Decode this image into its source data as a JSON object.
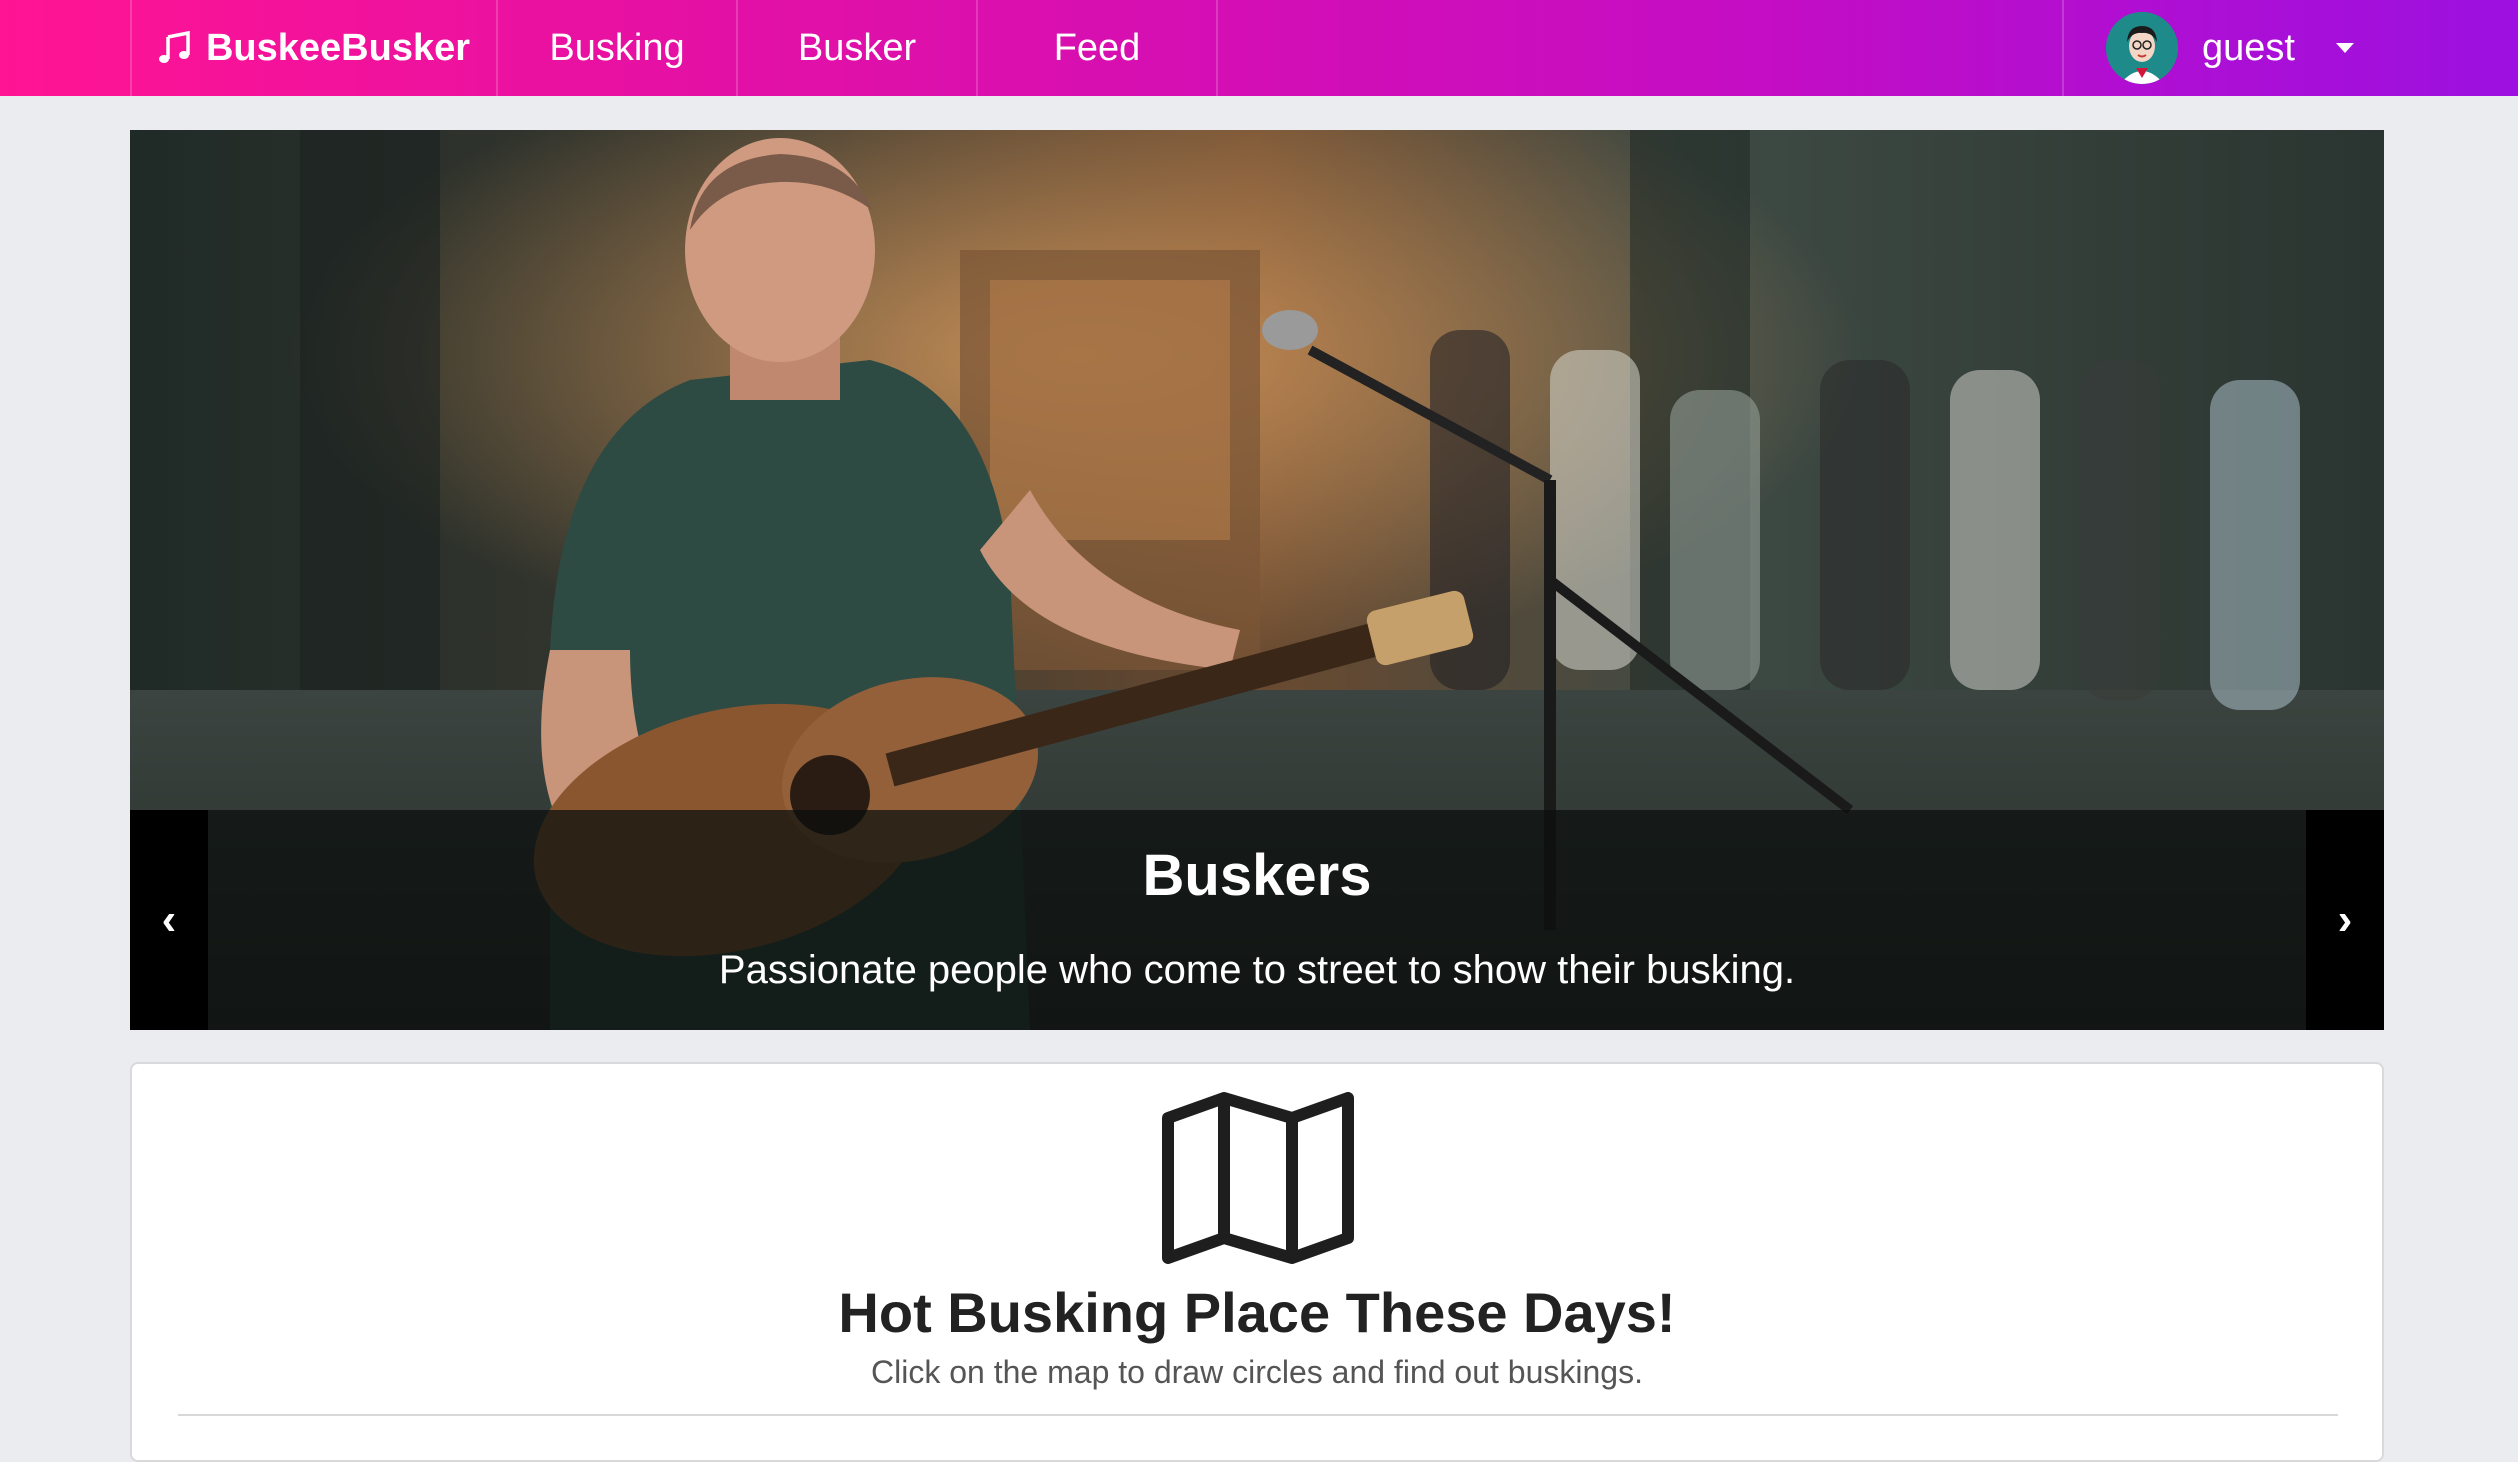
{
  "nav": {
    "brand": "BuskeeBusker",
    "brand_icon": "music-note-icon",
    "items": [
      {
        "label": "Busking"
      },
      {
        "label": "Busker"
      },
      {
        "label": "Feed"
      }
    ],
    "user": {
      "name": "guest",
      "caret_icon": "caret-down-icon"
    }
  },
  "carousel": {
    "slide_title": "Buskers",
    "slide_text": "Passionate people who come to street to show their busking.",
    "prev_label": "‹",
    "next_label": "›"
  },
  "map_section": {
    "icon": "map-icon",
    "title": "Hot Busking Place These Days!",
    "subtitle": "Click on the map to draw circles and find out buskings."
  },
  "colors": {
    "nav_gradient_start": "#ff1493",
    "nav_gradient_end": "#9c10e0",
    "page_bg": "#ebecef"
  }
}
